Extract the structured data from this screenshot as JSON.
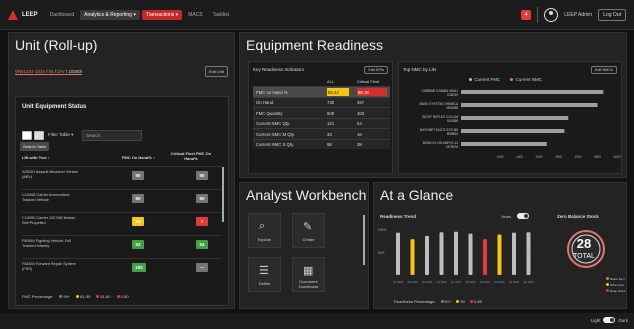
{
  "app": {
    "name": "LEEP"
  },
  "nav": {
    "dashboard": "Dashboard",
    "analytics": "Analytics & Reporting ▾",
    "transactions": "Transactions ▾",
    "macs": "MACS",
    "tasklist": "Tasklist"
  },
  "header": {
    "notifications": "4",
    "user": "LEEP Admin",
    "logout": "Log Out"
  },
  "unit": {
    "title": "Unit (Roll-up)",
    "breadcrumb": [
      "WW1234-1024",
      "IN",
      "DIV",
      "1034th"
    ],
    "edit_label": "Edit Unit",
    "status": {
      "title": "Unit Equipment Status",
      "filter_label": "Filter Table ▾",
      "search_placeholder": "Search",
      "tooltip": "Search Table",
      "col_lin": "LIN with Text ↕",
      "col_fmc": "FMC On Hand% ↕",
      "col_crit": "Critical Fleet FMC On Hand%",
      "rows": [
        {
          "name": "A05001 Assault Breacher Vehicle (ABV)",
          "fmc": "50",
          "crit": "50",
          "fmc_color": "#757575",
          "crit_color": "#757575"
        },
        {
          "name": "C10908 Carrier Ammunition: Tracked Vehicle",
          "fmc": "50",
          "crit": "50",
          "fmc_color": "#757575",
          "crit_color": "#757575"
        },
        {
          "name": "C10990 Carrier 120 MM Mortar: Self Propelled",
          "fmc": "83",
          "crit": "7",
          "fmc_color": "#f5c518",
          "crit_color": "#e53935"
        },
        {
          "name": "F60564 Fighting Vehicle: Full Tracked Infantry",
          "fmc": "93",
          "crit": "94",
          "fmc_color": "#43a047",
          "crit_color": "#43a047"
        },
        {
          "name": "F64544 Forward Repair System (FRS)",
          "fmc": "100",
          "crit": "—",
          "fmc_color": "#43a047",
          "crit_color": "#757575"
        }
      ],
      "legend_title": "FMC Percentage:",
      "legend": [
        {
          "label": "90+",
          "color": "#43a047"
        },
        {
          "label": "81-90",
          "color": "#f5c518"
        },
        {
          "label": "51-80",
          "color": "#e53935"
        },
        {
          "label": "0-50",
          "color": "#e53935"
        }
      ]
    }
  },
  "readiness": {
    "title": "Equipment Readiness",
    "kri": {
      "title": "Key Readiness Indicators",
      "edit_label": "Edit KPIs",
      "col_all": "ALL",
      "col_crit": "Critical Fleet",
      "rows": [
        {
          "label": "FMC on Hand %",
          "all": "83.42",
          "crit": "88.18"
        },
        {
          "label": "On Hand",
          "all": "730",
          "crit": "457"
        },
        {
          "label": "FMC Quantity",
          "all": "609",
          "crit": "403"
        },
        {
          "label": "Current NMC Qty.",
          "all": "121",
          "crit": "54"
        },
        {
          "label": "Current NMC M Qty.",
          "all": "33",
          "crit": "16"
        },
        {
          "label": "Current NMC S Qty.",
          "all": "88",
          "crit": "38"
        }
      ]
    },
    "nmc": {
      "title": "Top NMC by LIN",
      "edit_label": "Edit NMCs",
      "legend": [
        {
          "label": "Current FMC",
          "color": "#bdbdbd"
        },
        {
          "label": "Current NMC",
          "color": "#e57373"
        }
      ]
    }
  },
  "chart_data": [
    {
      "type": "bar",
      "title": "Top NMC by LIN",
      "categories": [
        "CARBINE 5.56MM: M4A1 C08019",
        "MASK SYSTEM CHEMICA M53086",
        "SIGHT REFLEX COLLIM S04358",
        "BAYONET MULTI-SYS M8 B08894",
        "MONO N VIS ANPVS-14 M79678"
      ],
      "series": [
        {
          "name": "Current FMC",
          "values": [
            3650,
            3500,
            2750,
            2650,
            2200
          ]
        },
        {
          "name": "Current NMC",
          "values": [
            0,
            0,
            0,
            0,
            0
          ]
        }
      ],
      "x_ticks": [
        "1000",
        "1500",
        "2000",
        "2500",
        "3000",
        "3500",
        "4000"
      ],
      "xlim": [
        0,
        4000
      ]
    },
    {
      "type": "bar",
      "title": "Readiness Trend",
      "categories": [
        "Q1",
        "Q2",
        "Q3",
        "Q4",
        "Q1",
        "Q2",
        "Q3",
        "Q4",
        "Q1",
        "Q2"
      ],
      "tick_labels": [
        "Q1 2023",
        "Q2 2023",
        "Q3 2023",
        "Q4 2023",
        "Q1 2024",
        "Q2 2024",
        "Q3 2024",
        "Q4 2024",
        "Q1 2025",
        "Q2 2025"
      ],
      "values": [
        92,
        78,
        85,
        93,
        94,
        90,
        78,
        88,
        92,
        93
      ],
      "y_ticks": [
        "100%",
        "50%"
      ],
      "ylim": [
        0,
        100
      ]
    }
  ],
  "glance": {
    "title": "At a Glance",
    "trend_label": "Readiness Trend",
    "years_label": "Years",
    "zero_label": "Zero Balance Stock",
    "gauge_value": "28",
    "gauge_label": "TOTAL",
    "gauge_legend": [
      {
        "label": "Board Item",
        "color": "#e57373"
      },
      {
        "label": "Other Item",
        "color": "#f5c518"
      },
      {
        "label": "Deep Stock",
        "color": "#e53935"
      }
    ],
    "legend_title": "Readiness Percentage:",
    "legend": [
      {
        "label": "91+",
        "color": "#43a047"
      },
      {
        "label": "90",
        "color": "#f5c518"
      },
      {
        "label": "0-89",
        "color": "#e53935"
      }
    ]
  },
  "workbench": {
    "title": "Analyst Workbench",
    "tiles": [
      {
        "label": "Explore"
      },
      {
        "label": "Create"
      },
      {
        "label": "Define"
      },
      {
        "label": "Document Dashboard"
      }
    ]
  },
  "footer": {
    "light": "Light",
    "dark": "Dark"
  }
}
